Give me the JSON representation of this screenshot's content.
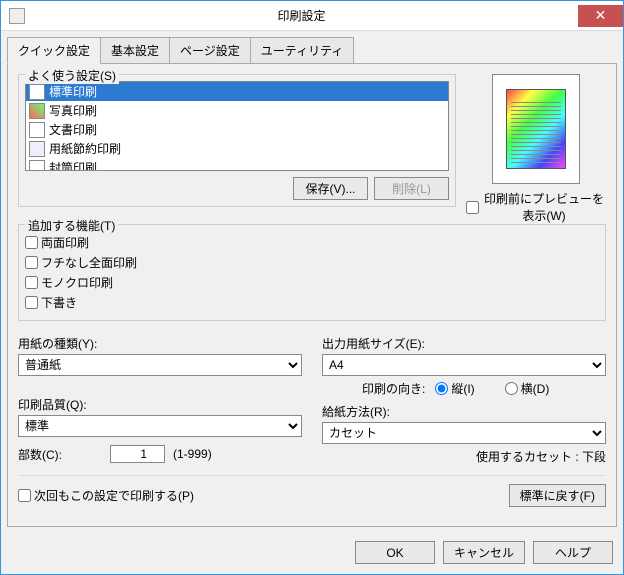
{
  "title": "印刷設定",
  "tabs": [
    "クイック設定",
    "基本設定",
    "ページ設定",
    "ユーティリティ"
  ],
  "presets": {
    "label": "よく使う設定(S)",
    "items": [
      "標準印刷",
      "写真印刷",
      "文書印刷",
      "用紙節約印刷",
      "封筒印刷"
    ],
    "save_btn": "保存(V)...",
    "delete_btn": "削除(L)"
  },
  "preview_chk": "印刷前にプレビューを表示(W)",
  "features": {
    "label": "追加する機能(T)",
    "duplex": "両面印刷",
    "borderless": "フチなし全面印刷",
    "mono": "モノクロ印刷",
    "draft": "下書き"
  },
  "media": {
    "label": "用紙の種類(Y):",
    "value": "普通紙"
  },
  "quality": {
    "label": "印刷品質(Q):",
    "value": "標準"
  },
  "copies": {
    "label": "部数(C):",
    "value": 1,
    "range": "(1-999)"
  },
  "size": {
    "label": "出力用紙サイズ(E):",
    "value": "A4"
  },
  "orient": {
    "label": "印刷の向き:",
    "portrait": "縦(I)",
    "landscape": "横(D)"
  },
  "source": {
    "label": "給紙方法(R):",
    "value": "カセット"
  },
  "cassette_note": "使用するカセット : 下段",
  "always_chk": "次回もこの設定で印刷する(P)",
  "defaults_btn": "標準に戻す(F)",
  "dlg": {
    "ok": "OK",
    "cancel": "キャンセル",
    "help": "ヘルプ"
  }
}
